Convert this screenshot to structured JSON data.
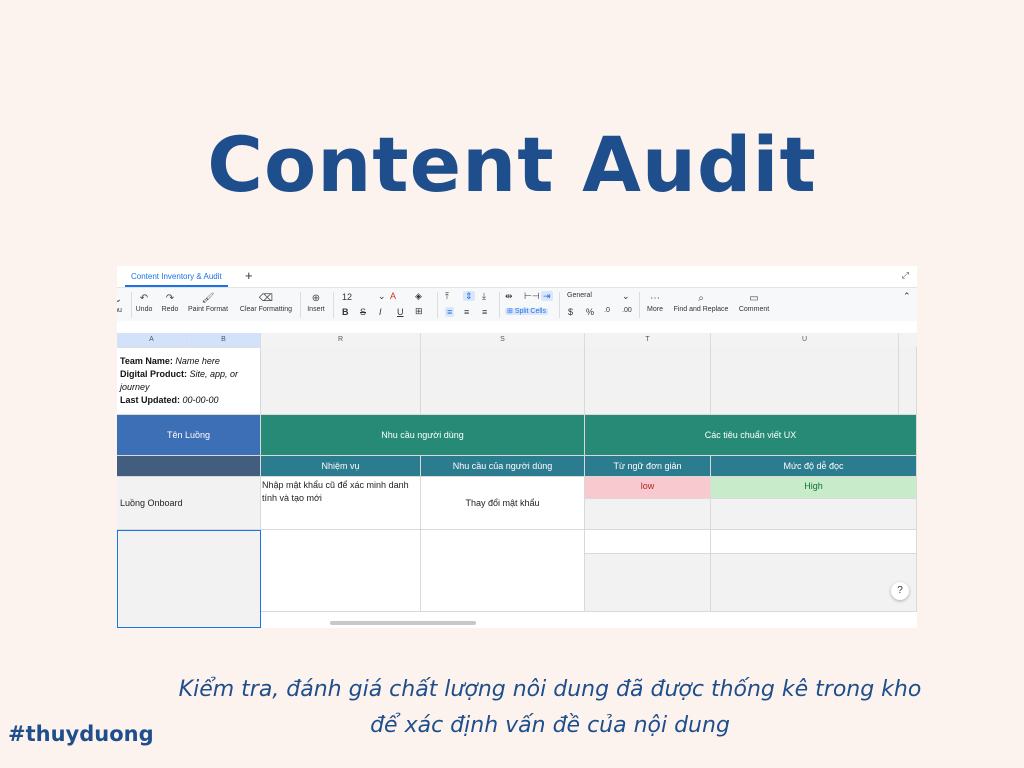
{
  "slide": {
    "title": "Content Audit",
    "caption_line1": "Kiểm tra, đánh giá chất lượng nôi dung đã được thống kê trong kho",
    "caption_line2": "để xác định vấn đề của nội dung",
    "hashtag": "#thuyduong"
  },
  "tabs": {
    "active": "Content Inventory & Audit",
    "add": "+"
  },
  "toolbar": {
    "menu_partial": "nu",
    "undo": "Undo",
    "redo": "Redo",
    "paint_format": "Paint Format",
    "clear_formatting": "Clear Formatting",
    "insert": "Insert",
    "font_size": "12",
    "split_cells": "Split Cells",
    "number_format": "General",
    "more": "More",
    "find_replace": "Find and Replace",
    "comment": "Comment"
  },
  "columns": [
    "A",
    "B",
    "R",
    "S",
    "T",
    "U"
  ],
  "info": {
    "team_label": "Team Name:",
    "team_value": "Name here",
    "product_label": "Digital Product:",
    "product_value": "Site, app, or journey",
    "updated_label": "Last Updated:",
    "updated_value": "00-00-00"
  },
  "headers": {
    "flow": "Tên Luồng",
    "user_needs": "Nhu cầu người dùng",
    "ux_standards": "Các tiêu chuẩn viết UX",
    "task": "Nhiệm vụ",
    "user_need": "Nhu cầu của người dùng",
    "simple_words": "Từ ngữ đơn giản",
    "readability": "Mức độ dễ đọc"
  },
  "rows": [
    {
      "flow": "Luồng Onboard",
      "task": "Nhập mật khẩu cũ để xác minh danh tính và tạo mới",
      "need": "Thay đổi mật khẩu",
      "simple_words": "low",
      "readability": "High"
    }
  ],
  "colors": {
    "title": "#1f4e8c",
    "background": "#fdf3ee",
    "header_blue": "#3d6fb6",
    "header_green": "#268a76",
    "header_teal": "#2a7c8e"
  }
}
